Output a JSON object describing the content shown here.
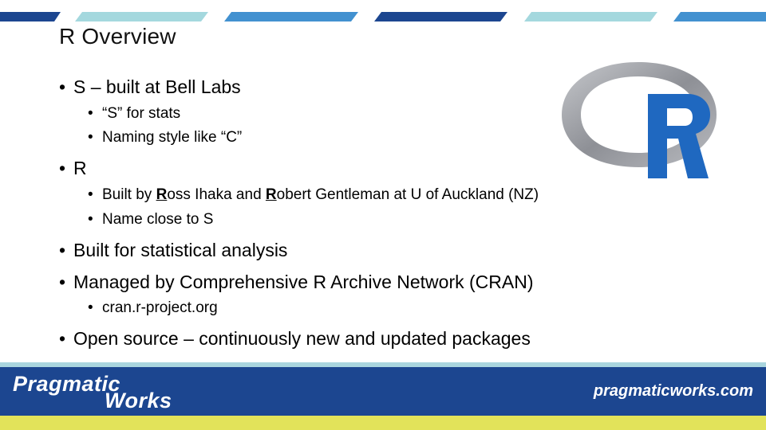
{
  "slide": {
    "title": "R Overview",
    "bullets": [
      {
        "level": 1,
        "text": "S – built at Bell Labs"
      },
      {
        "level": 2,
        "text": "“S” for stats"
      },
      {
        "level": 2,
        "text": "Naming style like “C”"
      },
      {
        "level": 1,
        "text": "R"
      },
      {
        "level": 2,
        "parts": [
          "Built by ",
          "R",
          "oss Ihaka and ",
          "R",
          "obert Gentleman at U of Auckland (NZ)"
        ]
      },
      {
        "level": 2,
        "text": "Name close to S"
      },
      {
        "level": 1,
        "text": "Built for statistical analysis"
      },
      {
        "level": 1,
        "text": "Managed by Comprehensive R Archive Network (CRAN)"
      },
      {
        "level": 2,
        "text": "cran.r-project.org"
      },
      {
        "level": 1,
        "text": "Open source – continuously new and updated packages"
      }
    ],
    "bullet_glyph": "•"
  },
  "logo": {
    "icon": "r-logo-icon",
    "letter": "R",
    "ring_color": "#9a9ca3",
    "letter_color": "#1f68c0"
  },
  "footer": {
    "brand_line1": "Pragmatic",
    "brand_line2": "Works",
    "url": "pragmaticworks.com"
  },
  "colors": {
    "dark_blue": "#1c4690",
    "teal": "#a4d8de",
    "mid_blue": "#4291d0",
    "footer_yellow": "#e2e35a"
  }
}
